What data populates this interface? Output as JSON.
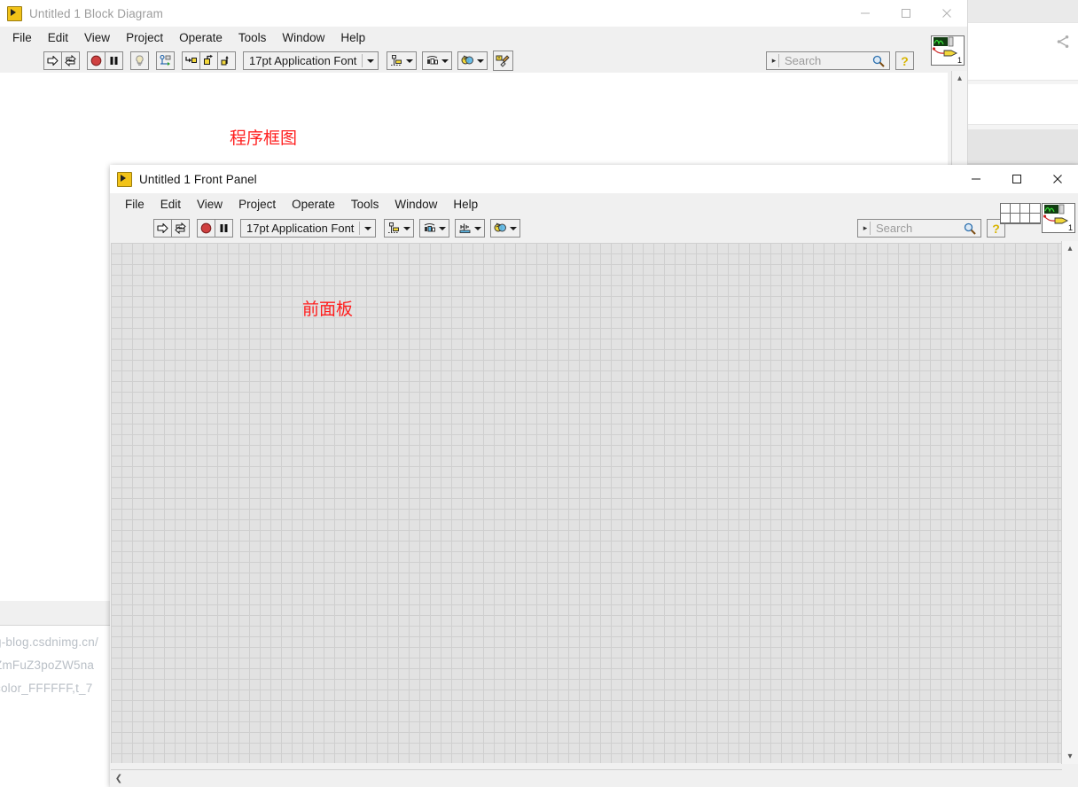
{
  "backdrop": {
    "share_icon": "share-icon",
    "watermark_lines": [
      "g-blog.csdnimg.cn/",
      "ZmFuZ3poZW5na",
      "color_FFFFFF,t_7"
    ],
    "scroll_left_arrow": "❮"
  },
  "block_diagram": {
    "title": "Untitled 1 Block Diagram",
    "app_icon": "labview-vi-icon",
    "menus": [
      "File",
      "Edit",
      "View",
      "Project",
      "Operate",
      "Tools",
      "Window",
      "Help"
    ],
    "window_controls": [
      {
        "name": "minimize-button",
        "glyph": "—"
      },
      {
        "name": "maximize-button",
        "glyph": "□"
      },
      {
        "name": "close-button",
        "glyph": "✕"
      }
    ],
    "toolbar": {
      "run_button": "run-arrow-icon",
      "run_continuous_button": "run-continuously-icon",
      "abort_button": "abort-execution-icon",
      "pause_button": "pause-icon",
      "highlight_button": "highlight-execution-bulb-icon",
      "retain_values_button": "retain-wire-values-icon",
      "step_into_button": "step-into-icon",
      "step_over_button": "step-over-icon",
      "step_out_button": "step-out-icon",
      "font_label": "17pt Application Font",
      "align_button": "align-objects-icon",
      "distribute_button": "distribute-objects-icon",
      "reorder_button": "reorder-objects-icon",
      "cleanup_button": "clean-up-diagram-icon"
    },
    "search": {
      "placeholder": "Search",
      "dropdown_arrow": "▸",
      "search_icon": "magnifier-icon"
    },
    "help_button": {
      "name": "context-help-button",
      "glyph": "?"
    },
    "vi_icon": {
      "name": "vi-icon",
      "number": "1"
    },
    "annotation": "程序框图",
    "scroll": {
      "up_arrow": "▴",
      "down_arrow": "▾"
    }
  },
  "front_panel": {
    "title": "Untitled 1 Front Panel",
    "app_icon": "labview-vi-icon",
    "menus": [
      "File",
      "Edit",
      "View",
      "Project",
      "Operate",
      "Tools",
      "Window",
      "Help"
    ],
    "window_controls": [
      {
        "name": "minimize-button",
        "glyph": "—"
      },
      {
        "name": "maximize-button",
        "glyph": "□"
      },
      {
        "name": "close-button",
        "glyph": "✕"
      }
    ],
    "toolbar": {
      "run_button": "run-arrow-icon",
      "run_continuous_button": "run-continuously-icon",
      "abort_button": "abort-execution-icon",
      "pause_button": "pause-icon",
      "font_label": "17pt Application Font",
      "align_button": "align-objects-icon",
      "distribute_button": "distribute-objects-icon",
      "resize_button": "resize-objects-icon",
      "reorder_button": "reorder-objects-icon"
    },
    "search": {
      "placeholder": "Search",
      "dropdown_arrow": "▸",
      "search_icon": "magnifier-icon"
    },
    "help_button": {
      "name": "context-help-button",
      "glyph": "?"
    },
    "connector_pane": {
      "name": "connector-pane",
      "rows": 2,
      "cols": 4
    },
    "vi_icon": {
      "name": "vi-icon",
      "number": "1"
    },
    "annotation": "前面板",
    "scroll": {
      "up_arrow": "▴",
      "down_arrow": "▾",
      "left_arrow": "❮",
      "right_arrow": "❯"
    }
  },
  "colors": {
    "annotation_red": "#ff1e1e",
    "toolbar_gray": "#f0f0f0",
    "grid_bg": "#e2e2e2",
    "grid_line": "#cfcfcf",
    "canvas_white": "#ffffff"
  }
}
